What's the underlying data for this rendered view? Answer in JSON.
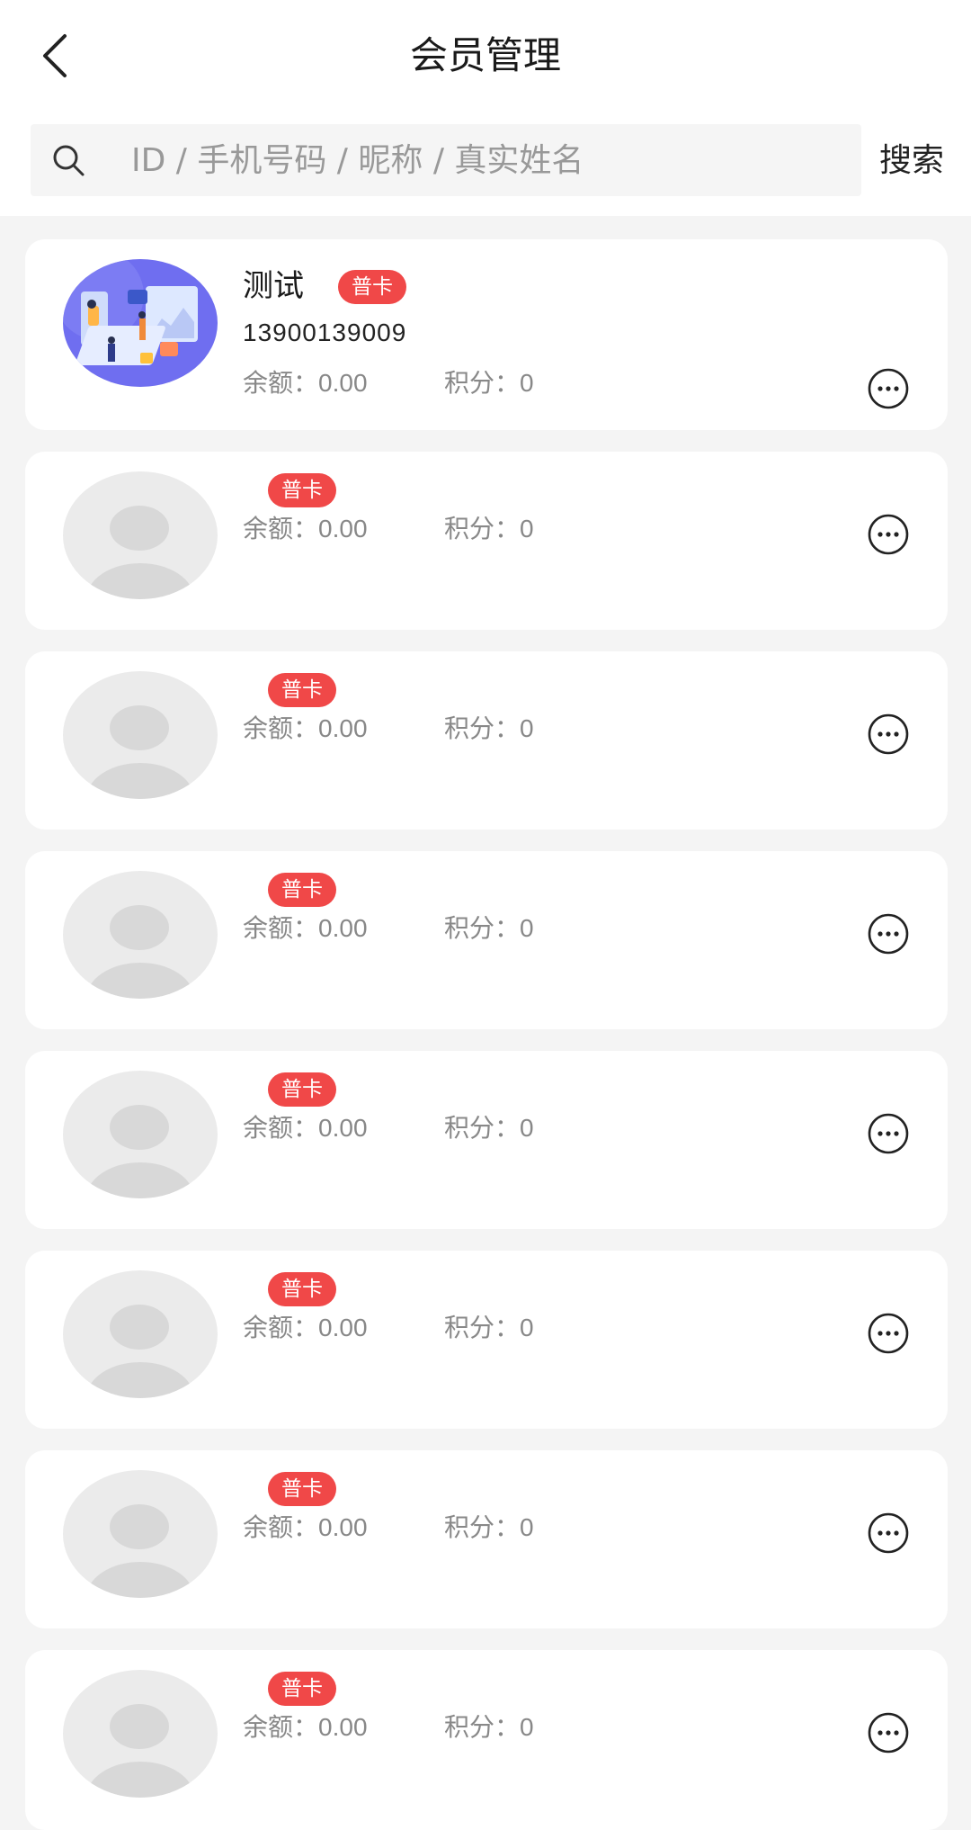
{
  "header": {
    "title": "会员管理",
    "back_icon": "back-arrow-icon"
  },
  "search": {
    "placeholder": "ID / 手机号码 / 昵称 / 真实姓名",
    "value": "",
    "button_label": "搜索",
    "icon": "search-icon"
  },
  "members": [
    {
      "name": "测试",
      "badge": "普卡",
      "phone": "13900139009",
      "balance_label": "余额：",
      "balance": "0.00",
      "points_label": "积分：",
      "points": "0",
      "avatar": "illustration"
    },
    {
      "name": "",
      "badge": "普卡",
      "phone": "",
      "balance_label": "余额：",
      "balance": "0.00",
      "points_label": "积分：",
      "points": "0",
      "avatar": "default"
    },
    {
      "name": "",
      "badge": "普卡",
      "phone": "",
      "balance_label": "余额：",
      "balance": "0.00",
      "points_label": "积分：",
      "points": "0",
      "avatar": "default"
    },
    {
      "name": "",
      "badge": "普卡",
      "phone": "",
      "balance_label": "余额：",
      "balance": "0.00",
      "points_label": "积分：",
      "points": "0",
      "avatar": "default"
    },
    {
      "name": "",
      "badge": "普卡",
      "phone": "",
      "balance_label": "余额：",
      "balance": "0.00",
      "points_label": "积分：",
      "points": "0",
      "avatar": "default"
    },
    {
      "name": "",
      "badge": "普卡",
      "phone": "",
      "balance_label": "余额：",
      "balance": "0.00",
      "points_label": "积分：",
      "points": "0",
      "avatar": "default"
    },
    {
      "name": "",
      "badge": "普卡",
      "phone": "",
      "balance_label": "余额：",
      "balance": "0.00",
      "points_label": "积分：",
      "points": "0",
      "avatar": "default"
    },
    {
      "name": "",
      "badge": "普卡",
      "phone": "",
      "balance_label": "余额：",
      "balance": "0.00",
      "points_label": "积分：",
      "points": "0",
      "avatar": "default"
    }
  ],
  "colors": {
    "badge": "#f04848",
    "background": "#f4f4f4",
    "card": "#ffffff",
    "muted_text": "#888888"
  }
}
